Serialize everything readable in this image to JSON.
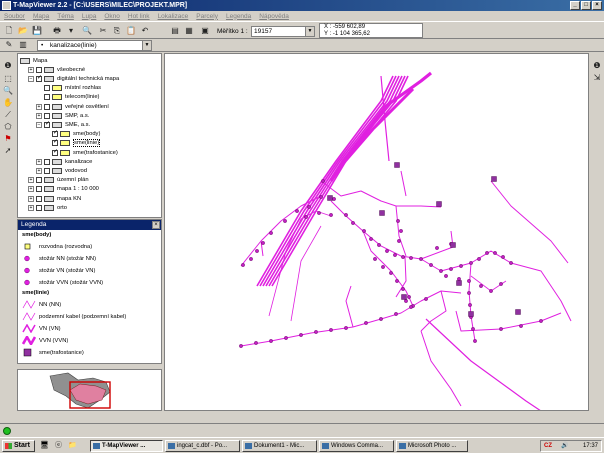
{
  "window": {
    "title": "T-MapViewer 2.2 - [C:\\USERS\\MILEC\\PROJEKT.MPR]",
    "minimize": "_",
    "maximize": "□",
    "close": "×"
  },
  "menu": [
    "Soubor",
    "Mapa",
    "Téma",
    "Lupa",
    "Okno",
    "Hot link",
    "Lokalizace",
    "Parcely",
    "Legenda",
    "Nápověda"
  ],
  "toolbar": {
    "scale_label": "Měřítko 1 :",
    "scale_value": "19157",
    "coord_x": "X : -559 602,89",
    "coord_y": "Y : -1 104 365,62"
  },
  "layer_select": {
    "value": "kanalizace(linie)",
    "prefix": "•"
  },
  "tree": [
    {
      "label": "Mapa",
      "level": 0,
      "expander": "",
      "checked": null,
      "icon": "folder"
    },
    {
      "label": "všeobecné",
      "level": 1,
      "expander": "+",
      "checked": false,
      "icon": "folder"
    },
    {
      "label": "digitální technická mapa",
      "level": 1,
      "expander": "−",
      "checked": true,
      "icon": "folder"
    },
    {
      "label": "místní rozhlas",
      "level": 2,
      "expander": "",
      "checked": false,
      "icon": "layer"
    },
    {
      "label": "telecom(linie)",
      "level": 2,
      "expander": "",
      "checked": false,
      "icon": "layer"
    },
    {
      "label": "veřejné osvětlení",
      "level": 2,
      "expander": "+",
      "checked": false,
      "icon": "folder"
    },
    {
      "label": "SMP, a.s.",
      "level": 2,
      "expander": "+",
      "checked": false,
      "icon": "folder"
    },
    {
      "label": "SME, a.s.",
      "level": 2,
      "expander": "−",
      "checked": true,
      "icon": "folder"
    },
    {
      "label": "sme(body)",
      "level": 3,
      "expander": "",
      "checked": true,
      "icon": "layer"
    },
    {
      "label": "sme(linie)",
      "level": 3,
      "expander": "",
      "checked": true,
      "icon": "layer-sel"
    },
    {
      "label": "sme(trafostanice)",
      "level": 3,
      "expander": "",
      "checked": true,
      "icon": "layer"
    },
    {
      "label": "kanalizace",
      "level": 2,
      "expander": "+",
      "checked": false,
      "icon": "folder"
    },
    {
      "label": "vodovod",
      "level": 2,
      "expander": "+",
      "checked": false,
      "icon": "folder"
    },
    {
      "label": "územní plán",
      "level": 1,
      "expander": "+",
      "checked": false,
      "icon": "folder"
    },
    {
      "label": "mapa 1 : 10 000",
      "level": 1,
      "expander": "+",
      "checked": false,
      "icon": "folder"
    },
    {
      "label": "mapa KN",
      "level": 1,
      "expander": "+",
      "checked": false,
      "icon": "folder"
    },
    {
      "label": "orto",
      "level": 1,
      "expander": "+",
      "checked": false,
      "icon": "folder"
    }
  ],
  "legend": {
    "title": "Legenda",
    "close": "×",
    "rows": [
      {
        "text": "sme(body)",
        "kind": "header"
      },
      {
        "text": "rozvodna (rozvodna)",
        "kind": "square-small"
      },
      {
        "text": "stožár NN (stožár NN)",
        "kind": "dot"
      },
      {
        "text": "stožár VN (stožár VN)",
        "kind": "dot"
      },
      {
        "text": "stožár VVN (stožár VVN)",
        "kind": "dot"
      },
      {
        "text": "sme(linie)",
        "kind": "header"
      },
      {
        "text": "NN (NN)",
        "kind": "line-thin"
      },
      {
        "text": "podzemní kabel (podzemní kabel)",
        "kind": "line-thin"
      },
      {
        "text": "VN (VN)",
        "kind": "line-med"
      },
      {
        "text": "VVN (VVN)",
        "kind": "line-thick"
      },
      {
        "text": "sme(trafostanice)",
        "kind": "square-big"
      }
    ]
  },
  "taskbar": {
    "start": "Start",
    "tasks": [
      "T-MapViewer ...",
      "ingcat_c.dbf - Po...",
      "Dokument1 - Mic...",
      "Windows Comma...",
      "Microsoft Photo ..."
    ],
    "clock": "17:37",
    "tray_text": "CZ"
  },
  "colors": {
    "network": "#e020e0",
    "titlebar": "#0a246a",
    "chrome": "#d4d0c8"
  }
}
